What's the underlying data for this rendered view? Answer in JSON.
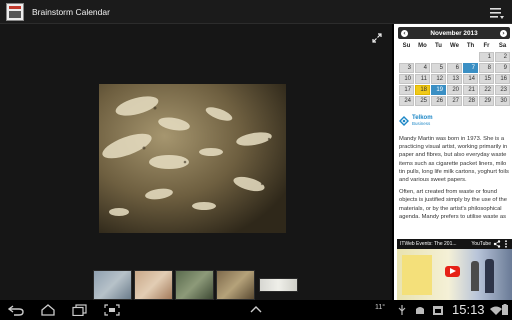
{
  "app": {
    "title": "Brainstorm Calendar"
  },
  "calendar": {
    "month_label": "November 2013",
    "prev_label": "‹",
    "next_label": "›",
    "weekdays": [
      "Su",
      "Mo",
      "Tu",
      "We",
      "Th",
      "Fr",
      "Sa"
    ],
    "weeks": [
      [
        "",
        "",
        "",
        "",
        "",
        "1",
        "2"
      ],
      [
        "3",
        "4",
        "5",
        "6",
        "7",
        "8",
        "9"
      ],
      [
        "10",
        "11",
        "12",
        "13",
        "14",
        "15",
        "16"
      ],
      [
        "17",
        "18",
        "19",
        "20",
        "21",
        "22",
        "23"
      ],
      [
        "24",
        "25",
        "26",
        "27",
        "28",
        "29",
        "30"
      ]
    ],
    "highlighted_blue": [
      "7",
      "19"
    ],
    "highlighted_yellow": [
      "18"
    ]
  },
  "sponsor": {
    "line1": "Telkom",
    "line2": "Business"
  },
  "bio": {
    "p1": "Mandy Martin was born in 1973. She is a practicing visual artist, working primarily in paper and fibres, but also everyday waste items such as cigarette packet liners, milo tin pulls, long life milk cartons, yoghurt foils and various sweet papers.",
    "p2": "Often, art created from waste or found objects is justified simply by the use of the materials, or by the artist's philosophical agenda. Mandy prefers to utilise waste as"
  },
  "video": {
    "title": "ITWeb Events: The 201...",
    "source_label": "YouTube"
  },
  "system": {
    "temperature": "11°",
    "clock": "15:13"
  },
  "colors": {
    "accent_blue": "#3a8fc4",
    "accent_yellow": "#f0c91a",
    "youtube_red": "#e62117"
  }
}
